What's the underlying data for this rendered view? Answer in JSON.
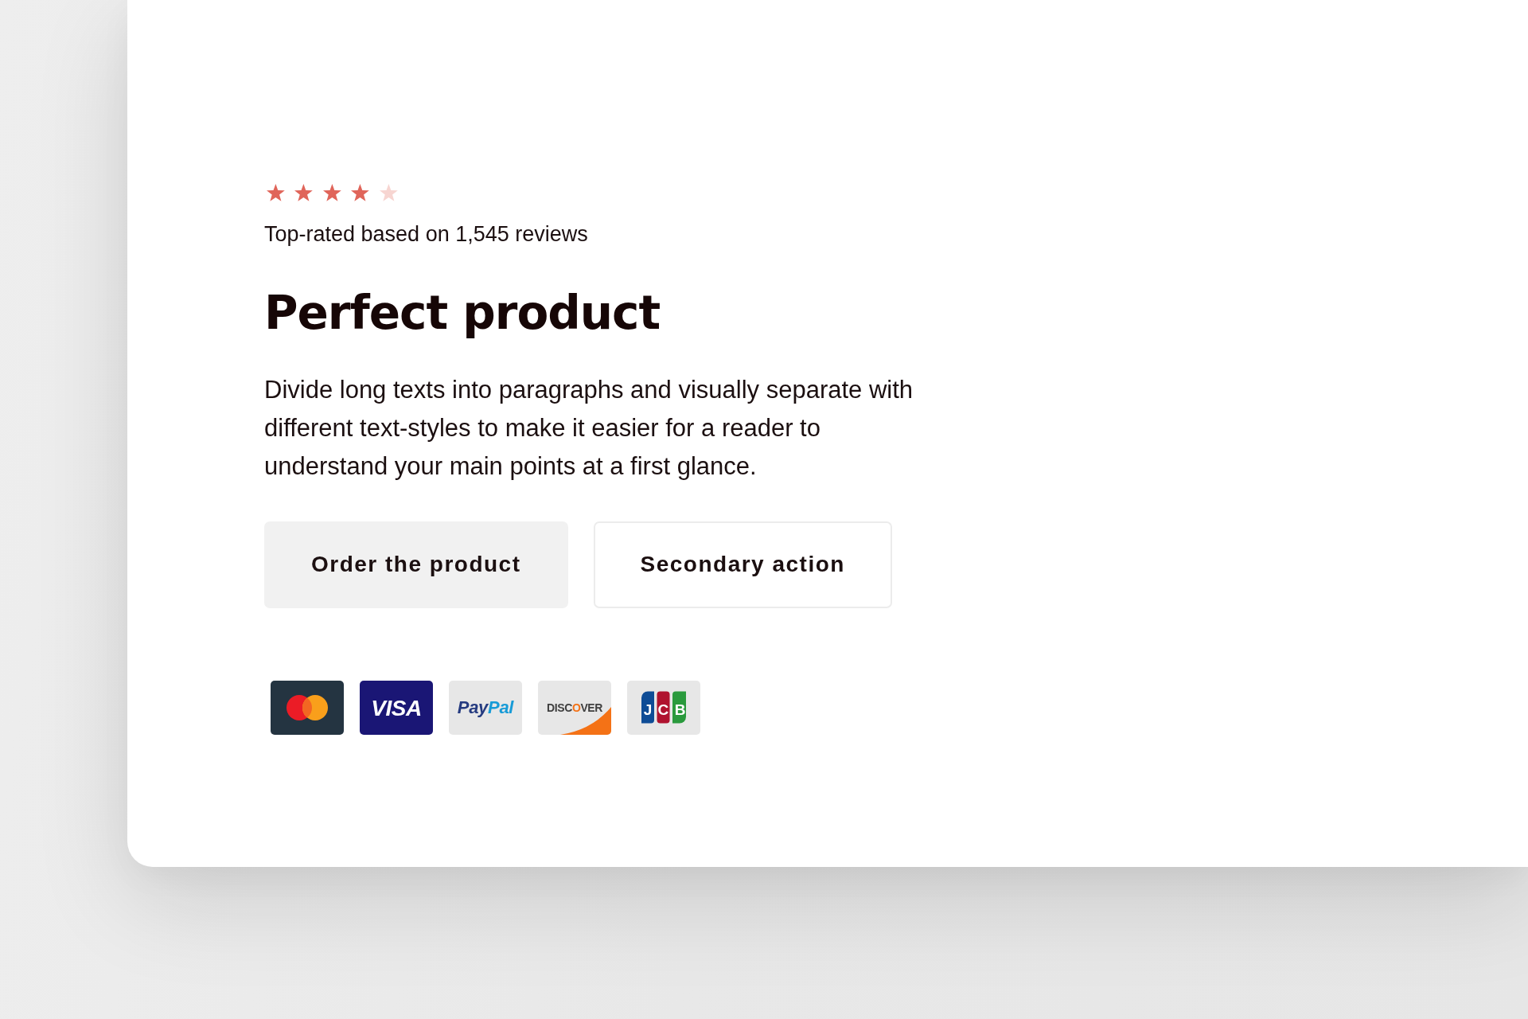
{
  "rating": {
    "stars": 4,
    "caption": "Top-rated based on 1,545 reviews"
  },
  "title": "Perfect product",
  "description": "Divide long texts into paragraphs and visually separate with different text-styles to make it easier for a reader to understand your main points at a first glance.",
  "buttons": [
    {
      "label": "Order the product",
      "kind": "primary"
    },
    {
      "label": "Secondary action",
      "kind": "secondary"
    }
  ],
  "payment_methods": [
    {
      "kind": "circles"
    },
    {
      "kind": "solid",
      "parts": [
        "VISA"
      ]
    },
    {
      "kind": "two-tone",
      "parts": [
        "Pay",
        "Pal"
      ]
    },
    {
      "kind": "swoosh",
      "parts": [
        "DISC",
        "O",
        "VER"
      ]
    },
    {
      "kind": "bars",
      "parts": [
        "JCB"
      ]
    }
  ]
}
